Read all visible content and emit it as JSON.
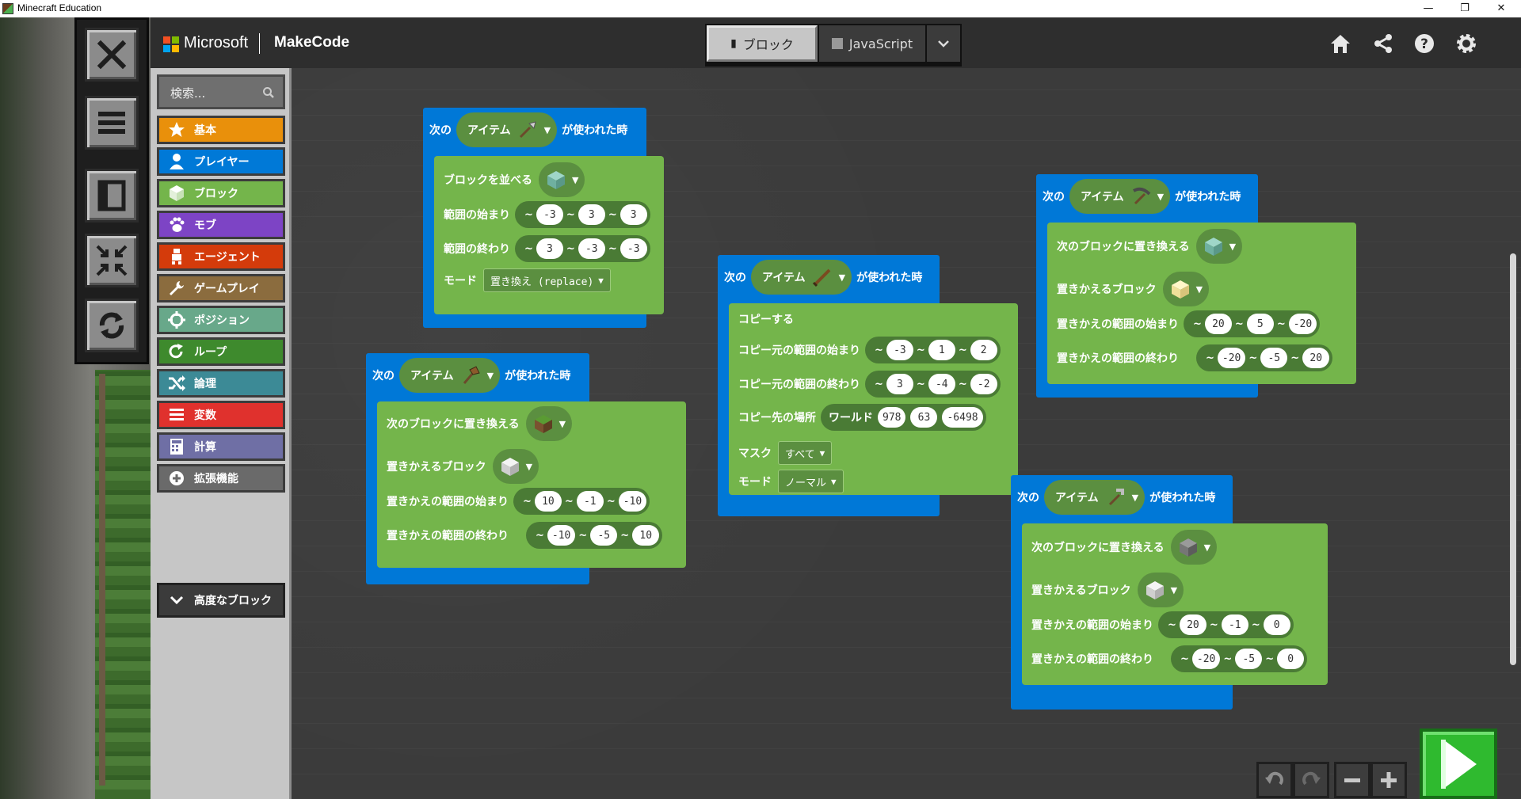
{
  "window": {
    "title": "Minecraft Education",
    "minimize": "—",
    "restore": "❐",
    "close": "✕"
  },
  "header": {
    "brand": "Microsoft",
    "product": "MakeCode",
    "tabs": [
      {
        "label": "ブロック"
      },
      {
        "label": "JavaScript"
      }
    ],
    "colors": {
      "ms_red": "#f25022",
      "ms_green": "#7fba00",
      "ms_blue": "#00a4ef",
      "ms_yellow": "#ffb900"
    }
  },
  "toolbox": {
    "search_placeholder": "検索...",
    "categories": [
      {
        "label": "基本",
        "color": "#e9900b",
        "icon": "star-icon"
      },
      {
        "label": "プレイヤー",
        "color": "#0079d7",
        "icon": "person-icon"
      },
      {
        "label": "ブロック",
        "color": "#74b54b",
        "icon": "cube-icon"
      },
      {
        "label": "モブ",
        "color": "#7d44c5",
        "icon": "paw-icon"
      },
      {
        "label": "エージェント",
        "color": "#d43b0b",
        "icon": "agent-icon"
      },
      {
        "label": "ゲームプレイ",
        "color": "#8b6c3e",
        "icon": "wrench-icon"
      },
      {
        "label": "ポジション",
        "color": "#68a88a",
        "icon": "crosshair-icon"
      },
      {
        "label": "ループ",
        "color": "#3e8a2d",
        "icon": "loop-icon"
      },
      {
        "label": "論理",
        "color": "#3c8a96",
        "icon": "shuffle-icon"
      },
      {
        "label": "変数",
        "color": "#e0312d",
        "icon": "list-icon"
      },
      {
        "label": "計算",
        "color": "#6f6fa5",
        "icon": "calculator-icon"
      },
      {
        "label": "拡張機能",
        "color": "#6a6a6a",
        "icon": "plus-circle-icon"
      }
    ],
    "advanced": "高度なブロック"
  },
  "blocks": {
    "evt_prefix": "次の",
    "evt_item": "アイテム",
    "evt_suffix": "が使われた時",
    "b1": {
      "row1": "ブロックを並べる",
      "row2": "範囲の始まり",
      "row2_vals": [
        "-3",
        "3",
        "3"
      ],
      "row3": "範囲の終わり",
      "row3_vals": [
        "3",
        "-3",
        "-3"
      ],
      "row4": "モード",
      "row4_val": "置き換え (replace)"
    },
    "b2": {
      "row1": "次のブロックに置き換える",
      "row2": "置きかえるブロック",
      "row3": "置きかえの範囲の始まり",
      "row3_vals": [
        "10",
        "-1",
        "-10"
      ],
      "row4": "置きかえの範囲の終わり",
      "row4_vals": [
        "-10",
        "-5",
        "10"
      ]
    },
    "b3": {
      "row1": "コピーする",
      "row2": "コピー元の範囲の始まり",
      "row2_vals": [
        "-3",
        "1",
        "2"
      ],
      "row3": "コピー元の範囲の終わり",
      "row3_vals": [
        "3",
        "-4",
        "-2"
      ],
      "row4": "コピー先の場所",
      "row4_world": "ワールド",
      "row4_vals": [
        "978",
        "63",
        "-6498"
      ],
      "row5": "マスク",
      "row5_val": "すべて",
      "row6": "モード",
      "row6_val": "ノーマル"
    },
    "b4": {
      "row1": "次のブロックに置き換える",
      "row2": "置きかえるブロック",
      "row3": "置きかえの範囲の始まり",
      "row3_vals": [
        "20",
        "5",
        "-20"
      ],
      "row4": "置きかえの範囲の終わり",
      "row4_vals": [
        "-20",
        "-5",
        "20"
      ]
    },
    "b5": {
      "row1": "次のブロックに置き換える",
      "row2": "置きかえるブロック",
      "row3": "置きかえの範囲の始まり",
      "row3_vals": [
        "20",
        "-1",
        "0"
      ],
      "row4": "置きかえの範囲の終わり",
      "row4_vals": [
        "-20",
        "-5",
        "0"
      ]
    }
  },
  "tilde": "~"
}
